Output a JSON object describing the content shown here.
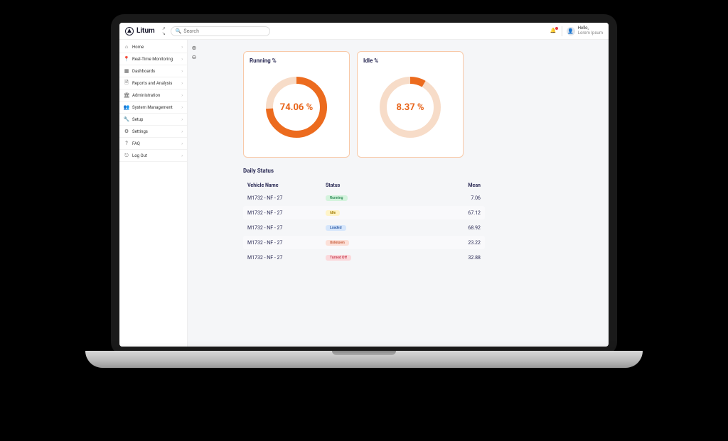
{
  "brand": {
    "name": "Litum"
  },
  "search": {
    "placeholder": "Search"
  },
  "user": {
    "hello": "Hello,",
    "name": "Lorem Ipsum"
  },
  "sidebar": {
    "items": [
      {
        "icon": "home",
        "label": "Home"
      },
      {
        "icon": "pin",
        "label": "Real-Time Monitoring"
      },
      {
        "icon": "grid",
        "label": "Dashboards"
      },
      {
        "icon": "report",
        "label": "Reports and Analysis"
      },
      {
        "icon": "admin",
        "label": "Administration"
      },
      {
        "icon": "system",
        "label": "System Management"
      },
      {
        "icon": "wrench",
        "label": "Setup"
      },
      {
        "icon": "gear",
        "label": "Settings"
      },
      {
        "icon": "faq",
        "label": "FAQ"
      },
      {
        "icon": "logout",
        "label": "Log Out"
      }
    ]
  },
  "chart_data": [
    {
      "type": "donut",
      "title": "Running %",
      "value": 74.06,
      "display": "74.06 %",
      "max": 100,
      "color": "#EC6B1E",
      "track": "#f7dcc8"
    },
    {
      "type": "donut",
      "title": "Idle %",
      "value": 8.37,
      "display": "8.37 %",
      "max": 100,
      "color": "#EC6B1E",
      "track": "#f7dcc8"
    }
  ],
  "table": {
    "title": "Daily Status",
    "headers": {
      "name": "Vehicle Name",
      "status": "Status",
      "mean": "Mean"
    },
    "rows": [
      {
        "name": "M1732 - NF - 27",
        "status": "Running",
        "badgeClass": "running",
        "mean": "7.06"
      },
      {
        "name": "M1732 - NF - 27",
        "status": "Idle",
        "badgeClass": "idle",
        "mean": "67.12"
      },
      {
        "name": "M1732 - NF - 27",
        "status": "Loaded",
        "badgeClass": "loaded",
        "mean": "68.92"
      },
      {
        "name": "M1732 - NF - 27",
        "status": "Unknown",
        "badgeClass": "unknown",
        "mean": "23.22"
      },
      {
        "name": "M1732 - NF - 27",
        "status": "Turned Off",
        "badgeClass": "turnedoff",
        "mean": "32.88"
      }
    ]
  },
  "icons": {
    "home": "⌂",
    "pin": "📍",
    "grid": "▦",
    "report": "🗎",
    "admin": "🏛",
    "system": "👥",
    "wrench": "🔧",
    "gear": "⚙",
    "faq": "?",
    "logout": "⎋",
    "search": "🔍",
    "bell": "🔔",
    "avatar": "👤",
    "chev": "›",
    "zoomin": "⊕",
    "zoomout": "⊖",
    "collapse1": "↗",
    "collapse2": "↘"
  }
}
